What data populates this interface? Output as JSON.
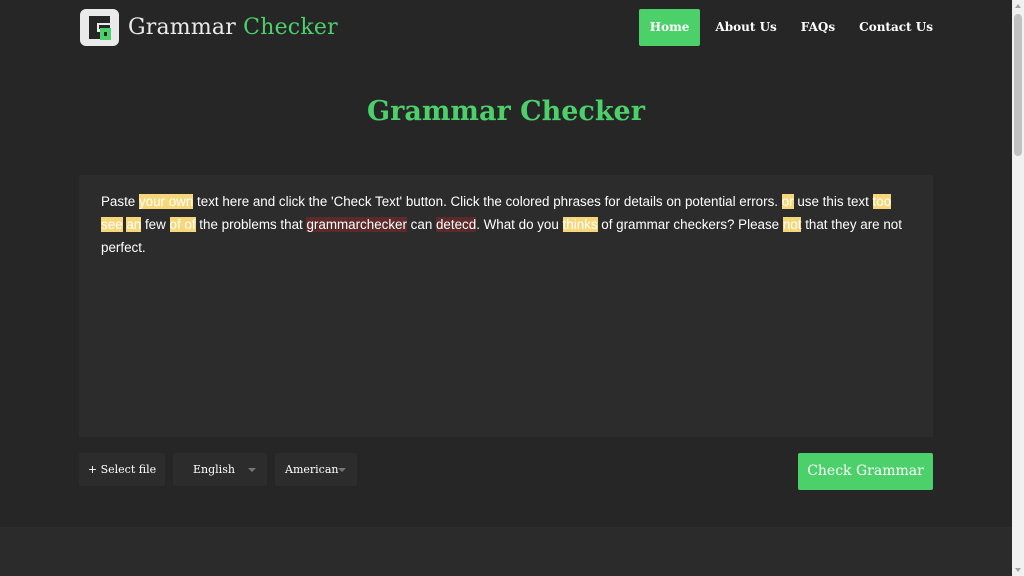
{
  "logo": {
    "word1": "Grammar",
    "word2": "Checker"
  },
  "nav": {
    "home": "Home",
    "about": "About Us",
    "faqs": "FAQs",
    "contact": "Contact Us"
  },
  "page_title": "Grammar Checker",
  "editor": {
    "segments": [
      {
        "t": "Paste "
      },
      {
        "t": "your own",
        "hl": "yellow"
      },
      {
        "t": " text here and click the 'Check Text' button. Click the colored phrases for details on potential errors. "
      },
      {
        "t": "or",
        "hl": "yellow"
      },
      {
        "t": " use this text "
      },
      {
        "t": "too",
        "hl": "yellow"
      },
      {
        "t": " "
      },
      {
        "t": "see",
        "hl": "yellow"
      },
      {
        "t": " "
      },
      {
        "t": "an",
        "hl": "yellow"
      },
      {
        "t": " few "
      },
      {
        "t": "of of",
        "hl": "yellow"
      },
      {
        "t": " the problems that "
      },
      {
        "t": "grammarchecker",
        "hl": "red"
      },
      {
        "t": " can "
      },
      {
        "t": "detecd",
        "hl": "red"
      },
      {
        "t": ". What do you "
      },
      {
        "t": "thinks",
        "hl": "yellow"
      },
      {
        "t": " of grammar checkers? Please "
      },
      {
        "t": "not",
        "hl": "yellow"
      },
      {
        "t": " that they are not perfect."
      }
    ]
  },
  "toolbar": {
    "select_file": "+ Select file",
    "language": "English",
    "dialect": "American",
    "check_button": "Check Grammar"
  },
  "colors": {
    "accent": "#4cd06a",
    "background": "#262626",
    "panel": "#2c2c2c",
    "highlight_style": "#f6d77a",
    "highlight_spelling": "#5c2a2a"
  }
}
